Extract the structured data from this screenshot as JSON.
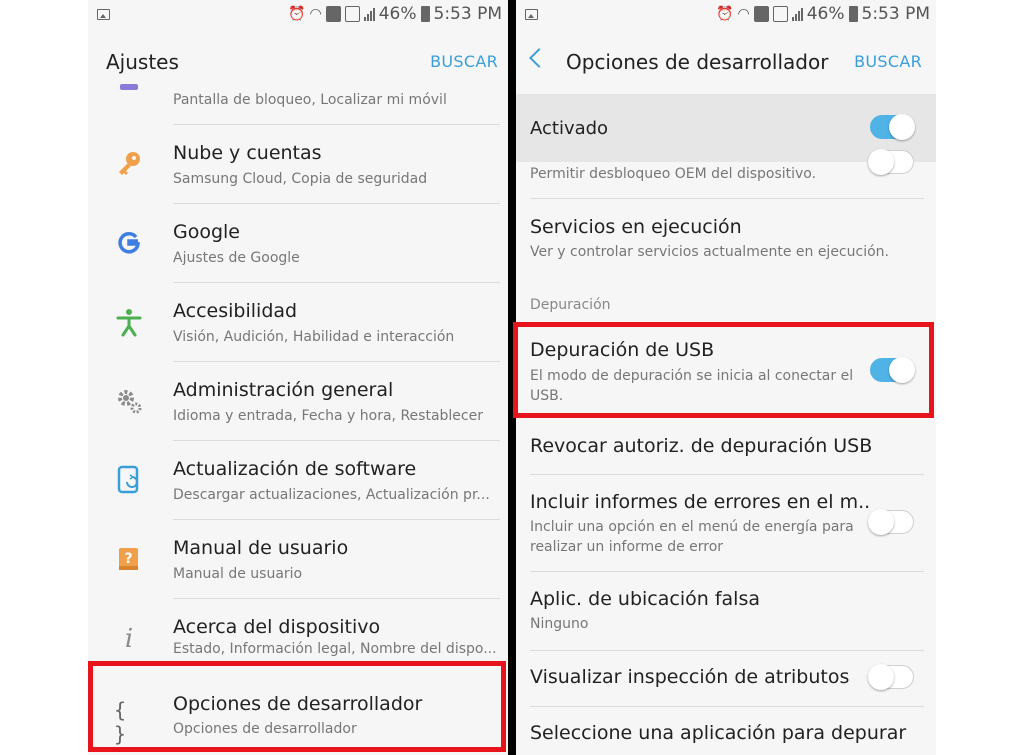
{
  "left": {
    "status": {
      "battery": "46%",
      "time": "5:53 PM"
    },
    "header": {
      "title": "Ajustes",
      "search_label": "BUSCAR"
    },
    "items": [
      {
        "title": "",
        "subtitle": "Pantalla de bloqueo, Localizar mi móvil",
        "icon": "lock-icon"
      },
      {
        "title": "Nube y cuentas",
        "subtitle": "Samsung Cloud, Copia de seguridad",
        "icon": "key-icon"
      },
      {
        "title": "Google",
        "subtitle": "Ajustes de Google",
        "icon": "google-icon"
      },
      {
        "title": "Accesibilidad",
        "subtitle": "Visión, Audición, Habilidad e interacción",
        "icon": "accessibility-icon"
      },
      {
        "title": "Administración general",
        "subtitle": "Idioma y entrada, Fecha y hora, Restablecer",
        "icon": "gears-icon"
      },
      {
        "title": "Actualización de software",
        "subtitle": "Descargar actualizaciones, Actualización pr...",
        "icon": "software-update-icon"
      },
      {
        "title": "Manual de usuario",
        "subtitle": "Manual de usuario",
        "icon": "user-manual-icon"
      },
      {
        "title": "Acerca del dispositivo",
        "subtitle": "Estado, Información legal, Nombre del dispo...",
        "icon": "info-icon"
      },
      {
        "title": "Opciones de desarrollador",
        "subtitle": "Opciones de desarrollador",
        "icon": "developer-braces-icon",
        "glyph": "{ }"
      }
    ]
  },
  "right": {
    "status": {
      "battery": "46%",
      "time": "5:53 PM"
    },
    "header": {
      "title": "Opciones de desarrollador",
      "search_label": "BUSCAR"
    },
    "activado": {
      "label": "Activado",
      "on": true
    },
    "oem_subtitle": "Permitir desbloqueo OEM del dispositivo.",
    "running": {
      "title": "Servicios en ejecución",
      "subtitle": "Ver y controlar servicios actualmente en ejecución."
    },
    "section": "Depuración",
    "usb_debug": {
      "title": "Depuración de USB",
      "subtitle": "El modo de depuración se inicia al conectar el USB.",
      "on": true
    },
    "revoke": {
      "title": "Revocar autoriz. de depuración USB"
    },
    "bug_reports": {
      "title": "Incluir informes de errores en el m..",
      "subtitle": "Incluir una opción en el menú de energía para realizar un informe de error",
      "on": false
    },
    "mock_location": {
      "title": "Aplic. de ubicación falsa",
      "subtitle": "Ninguno"
    },
    "view_attr": {
      "title": "Visualizar inspección de atributos",
      "on": false
    },
    "select_debug_app": {
      "title": "Seleccione una aplicación para depurar"
    }
  },
  "colors": {
    "accent": "#4fb3e6",
    "highlight": "#e8141c",
    "key": "#f0a04b",
    "google": "#3d7ee0",
    "accessibility": "#4caf50",
    "update": "#3a9ed8",
    "manual": "#f0a04b"
  }
}
